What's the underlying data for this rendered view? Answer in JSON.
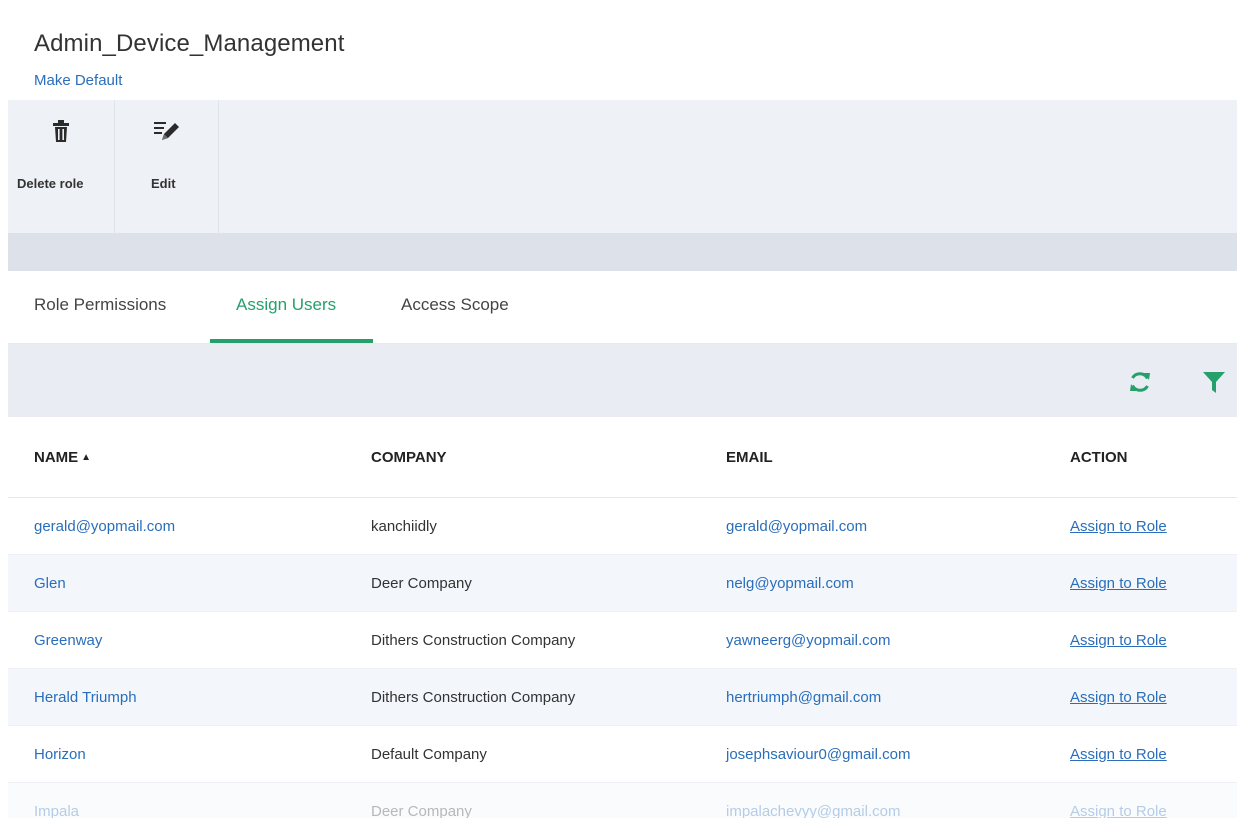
{
  "header": {
    "title": "Admin_Device_Management",
    "make_default": "Make Default"
  },
  "toolbar": {
    "delete_label": "Delete role",
    "edit_label": "Edit"
  },
  "tabs": [
    {
      "label": "Role Permissions",
      "active": false
    },
    {
      "label": "Assign Users",
      "active": true
    },
    {
      "label": "Access Scope",
      "active": false
    }
  ],
  "grid_toolbar": {
    "icons": [
      "refresh-icon",
      "filter-icon"
    ]
  },
  "table": {
    "columns": {
      "name": "NAME",
      "company": "COMPANY",
      "email": "EMAIL",
      "action": "ACTION"
    },
    "sort": {
      "column": "NAME",
      "direction": "ascending"
    },
    "rows": [
      {
        "name": "gerald@yopmail.com",
        "company": "kanchiidly",
        "email": "gerald@yopmail.com",
        "action": "Assign to Role"
      },
      {
        "name": "Glen",
        "company": "Deer Company",
        "email": "nelg@yopmail.com",
        "action": "Assign to Role"
      },
      {
        "name": "Greenway",
        "company": "Dithers Construction Company",
        "email": "yawneerg@yopmail.com",
        "action": "Assign to Role"
      },
      {
        "name": "Herald Triumph",
        "company": "Dithers Construction Company",
        "email": "hertriumph@gmail.com",
        "action": "Assign to Role"
      },
      {
        "name": "Horizon",
        "company": "Default Company",
        "email": "josephsaviour0@gmail.com",
        "action": "Assign to Role"
      },
      {
        "name": "Impala",
        "company": "Deer Company",
        "email": "impalachevyy@gmail.com",
        "action": "Assign to Role"
      }
    ]
  },
  "colors": {
    "accent_green": "#26a06a",
    "link_blue": "#2a6ebb",
    "toolbar_bg": "#eef1f6"
  }
}
